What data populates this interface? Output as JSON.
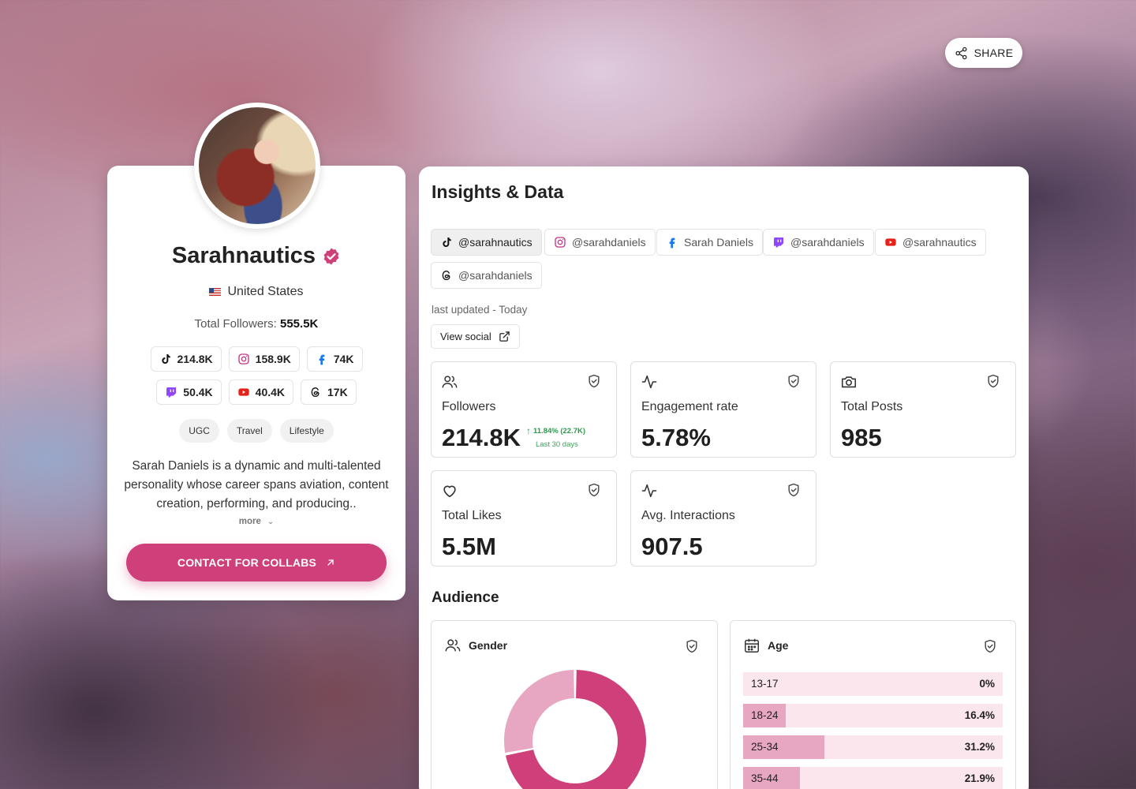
{
  "share": {
    "label": "SHARE"
  },
  "profile": {
    "name": "Sarahnautics",
    "country": "United States",
    "total_followers_label": "Total Followers:",
    "total_followers_value": "555.5K",
    "platforms": [
      {
        "platform": "tiktok",
        "icon": "tiktok-icon",
        "count": "214.8K"
      },
      {
        "platform": "instagram",
        "icon": "instagram-icon",
        "count": "158.9K"
      },
      {
        "platform": "facebook",
        "icon": "facebook-icon",
        "count": "74K"
      },
      {
        "platform": "twitch",
        "icon": "twitch-icon",
        "count": "50.4K"
      },
      {
        "platform": "youtube",
        "icon": "youtube-icon",
        "count": "40.4K"
      },
      {
        "platform": "threads",
        "icon": "threads-icon",
        "count": "17K"
      }
    ],
    "tags": [
      "UGC",
      "Travel",
      "Lifestyle"
    ],
    "bio": "Sarah Daniels is a dynamic and multi-talented personality whose career spans aviation, content creation, performing, and producing..",
    "more_label": "more",
    "contact_label": "CONTACT FOR COLLABS"
  },
  "insights": {
    "title": "Insights & Data",
    "socials": [
      {
        "icon": "tiktok-icon",
        "label": "@sarahnautics",
        "active": true
      },
      {
        "icon": "instagram-icon",
        "label": "@sarahdaniels",
        "active": false
      },
      {
        "icon": "facebook-icon",
        "label": "Sarah Daniels",
        "active": false
      },
      {
        "icon": "twitch-icon",
        "label": "@sarahdaniels",
        "active": false
      },
      {
        "icon": "youtube-icon",
        "label": "@sarahnautics",
        "active": false
      },
      {
        "icon": "threads-icon",
        "label": "@sarahdaniels",
        "active": false
      }
    ],
    "last_updated": "last updated - Today",
    "view_social_label": "View social",
    "stats": [
      {
        "icon": "users-icon",
        "label": "Followers",
        "value": "214.8K",
        "growth": "11.84% (22.7K)",
        "growth_period": "Last 30 days"
      },
      {
        "icon": "activity-icon",
        "label": "Engagement rate",
        "value": "5.78%"
      },
      {
        "icon": "camera-icon",
        "label": "Total Posts",
        "value": "985"
      },
      {
        "icon": "heart-icon",
        "label": "Total Likes",
        "value": "5.5M"
      },
      {
        "icon": "activity-icon",
        "label": "Avg. Interactions",
        "value": "907.5"
      }
    ]
  },
  "audience": {
    "title": "Audience",
    "gender": {
      "title": "Gender",
      "slices": [
        0.72,
        0.28
      ],
      "colors": [
        "#cf3f79",
        "#e7a7c2"
      ]
    },
    "age": {
      "title": "Age",
      "rows": [
        {
          "label": "13-17",
          "pct_text": "0%",
          "pct": 0
        },
        {
          "label": "18-24",
          "pct_text": "16.4%",
          "pct": 16.4
        },
        {
          "label": "25-34",
          "pct_text": "31.2%",
          "pct": 31.2
        },
        {
          "label": "35-44",
          "pct_text": "21.9%",
          "pct": 21.9
        }
      ]
    }
  },
  "colors": {
    "accent": "#cf3f79",
    "accent_light": "#e7a7c2",
    "growth": "#2e9a4e"
  }
}
